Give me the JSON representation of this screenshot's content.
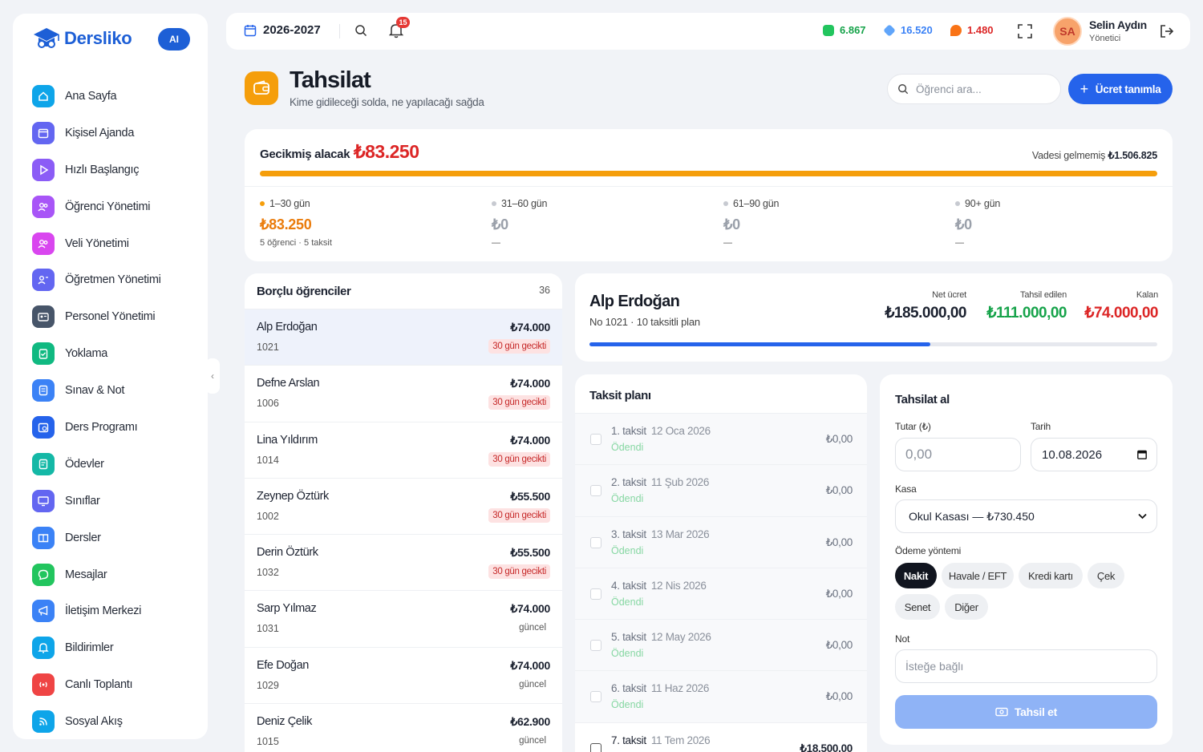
{
  "sidebar": {
    "logo": "Dersliko",
    "ai_badge": "AI",
    "items": [
      {
        "label": "Ana Sayfa",
        "icon": "home-icon",
        "color": "#0ea5e9"
      },
      {
        "label": "Kişisel Ajanda",
        "icon": "calendar-icon",
        "color": "#6366f1"
      },
      {
        "label": "Hızlı Başlangıç",
        "icon": "play-icon",
        "color": "#8b5cf6"
      },
      {
        "label": "Öğrenci Yönetimi",
        "icon": "users-icon",
        "color": "#a855f7"
      },
      {
        "label": "Veli Yönetimi",
        "icon": "users-icon",
        "color": "#d946ef"
      },
      {
        "label": "Öğretmen Yönetimi",
        "icon": "teacher-icon",
        "color": "#6366f1"
      },
      {
        "label": "Personel Yönetimi",
        "icon": "id-card-icon",
        "color": "#475569"
      },
      {
        "label": "Yoklama",
        "icon": "clipboard-check-icon",
        "color": "#10b981"
      },
      {
        "label": "Sınav & Not",
        "icon": "exam-icon",
        "color": "#3b82f6"
      },
      {
        "label": "Ders Programı",
        "icon": "schedule-icon",
        "color": "#2563eb"
      },
      {
        "label": "Ödevler",
        "icon": "homework-icon",
        "color": "#14b8a6"
      },
      {
        "label": "Sınıflar",
        "icon": "monitor-icon",
        "color": "#6366f1"
      },
      {
        "label": "Dersler",
        "icon": "book-icon",
        "color": "#3b82f6"
      },
      {
        "label": "Mesajlar",
        "icon": "chat-icon",
        "color": "#22c55e"
      },
      {
        "label": "İletişim Merkezi",
        "icon": "megaphone-icon",
        "color": "#3b82f6"
      },
      {
        "label": "Bildirimler",
        "icon": "bell-icon",
        "color": "#0ea5e9"
      },
      {
        "label": "Canlı Toplantı",
        "icon": "broadcast-icon",
        "color": "#ef4444"
      },
      {
        "label": "Sosyal Akış",
        "icon": "rss-icon",
        "color": "#0ea5e9"
      }
    ]
  },
  "topbar": {
    "year": "2026-2027",
    "notifications": "15",
    "stats": [
      {
        "value": "6.867",
        "color": "#16a34a",
        "icon": "money-icon"
      },
      {
        "value": "16.520",
        "color": "#1e40af",
        "icon": "diamond-icon"
      },
      {
        "value": "1.480",
        "color": "#dc2626",
        "icon": "fire-icon"
      }
    ],
    "user": {
      "initials": "SA",
      "name": "Selin Aydın",
      "role": "Yönetici"
    }
  },
  "header": {
    "title": "Tahsilat",
    "subtitle": "Kime gidileceği solda, ne yapılacağı sağda",
    "search_placeholder": "Öğrenci ara...",
    "add_button": "Ücret tanımla"
  },
  "overdue": {
    "label": "Gecikmiş alacak",
    "amount": "₺83.250",
    "not_due_label": "Vadesi gelmemiş",
    "not_due_amount": "₺1.506.825",
    "buckets": [
      {
        "label": "1–30 gün",
        "amount": "₺83.250",
        "sub": "5 öğrenci · 5 taksit",
        "color": "#f59e0b"
      },
      {
        "label": "31–60 gün",
        "amount": "₺0",
        "sub": "—",
        "color": "#c7cad1"
      },
      {
        "label": "61–90 gün",
        "amount": "₺0",
        "sub": "—",
        "color": "#c7cad1"
      },
      {
        "label": "90+ gün",
        "amount": "₺0",
        "sub": "—",
        "color": "#c7cad1"
      }
    ]
  },
  "debtors": {
    "title": "Borçlu öğrenciler",
    "count": "36",
    "rows": [
      {
        "name": "Alp Erdoğan",
        "no": "1021",
        "amount": "₺74.000",
        "status": "30 gün gecikti",
        "late": true
      },
      {
        "name": "Defne Arslan",
        "no": "1006",
        "amount": "₺74.000",
        "status": "30 gün gecikti",
        "late": true
      },
      {
        "name": "Lina Yıldırım",
        "no": "1014",
        "amount": "₺74.000",
        "status": "30 gün gecikti",
        "late": true
      },
      {
        "name": "Zeynep Öztürk",
        "no": "1002",
        "amount": "₺55.500",
        "status": "30 gün gecikti",
        "late": true
      },
      {
        "name": "Derin Öztürk",
        "no": "1032",
        "amount": "₺55.500",
        "status": "30 gün gecikti",
        "late": true
      },
      {
        "name": "Sarp Yılmaz",
        "no": "1031",
        "amount": "₺74.000",
        "status": "güncel",
        "late": false
      },
      {
        "name": "Efe Doğan",
        "no": "1029",
        "amount": "₺74.000",
        "status": "güncel",
        "late": false
      },
      {
        "name": "Deniz Çelik",
        "no": "1015",
        "amount": "₺62.900",
        "status": "güncel",
        "late": false
      }
    ]
  },
  "student": {
    "name": "Alp Erdoğan",
    "sub": "No 1021 · 10 taksitli plan",
    "net_label": "Net ücret",
    "net_value": "₺185.000,00",
    "collected_label": "Tahsil edilen",
    "collected_value": "₺111.000,00",
    "remaining_label": "Kalan",
    "remaining_value": "₺74.000,00",
    "progress": 0.6
  },
  "plan": {
    "title": "Taksit planı",
    "rows": [
      {
        "title": "1. taksit",
        "date": "12 Oca 2026",
        "state": "Ödendi",
        "amount": "₺0,00",
        "paid": true
      },
      {
        "title": "2. taksit",
        "date": "11 Şub 2026",
        "state": "Ödendi",
        "amount": "₺0,00",
        "paid": true
      },
      {
        "title": "3. taksit",
        "date": "13 Mar 2026",
        "state": "Ödendi",
        "amount": "₺0,00",
        "paid": true
      },
      {
        "title": "4. taksit",
        "date": "12 Nis 2026",
        "state": "Ödendi",
        "amount": "₺0,00",
        "paid": true
      },
      {
        "title": "5. taksit",
        "date": "12 May 2026",
        "state": "Ödendi",
        "amount": "₺0,00",
        "paid": true
      },
      {
        "title": "6. taksit",
        "date": "11 Haz 2026",
        "state": "Ödendi",
        "amount": "₺0,00",
        "paid": true
      },
      {
        "title": "7. taksit",
        "date": "11 Tem 2026",
        "state": "",
        "amount": "₺18.500,00",
        "paid": false
      }
    ]
  },
  "collect": {
    "title": "Tahsilat al",
    "amount_label": "Tutar (₺)",
    "amount_value": "0,00",
    "date_label": "Tarih",
    "date_value": "10.08.2026",
    "cash_label": "Kasa",
    "cash_value": "Okul Kasası — ₺730.450",
    "method_label": "Ödeme yöntemi",
    "methods": [
      "Nakit",
      "Havale / EFT",
      "Kredi kartı",
      "Çek",
      "Senet",
      "Diğer"
    ],
    "note_label": "Not",
    "note_placeholder": "İsteğe bağlı",
    "submit": "Tahsil et"
  }
}
